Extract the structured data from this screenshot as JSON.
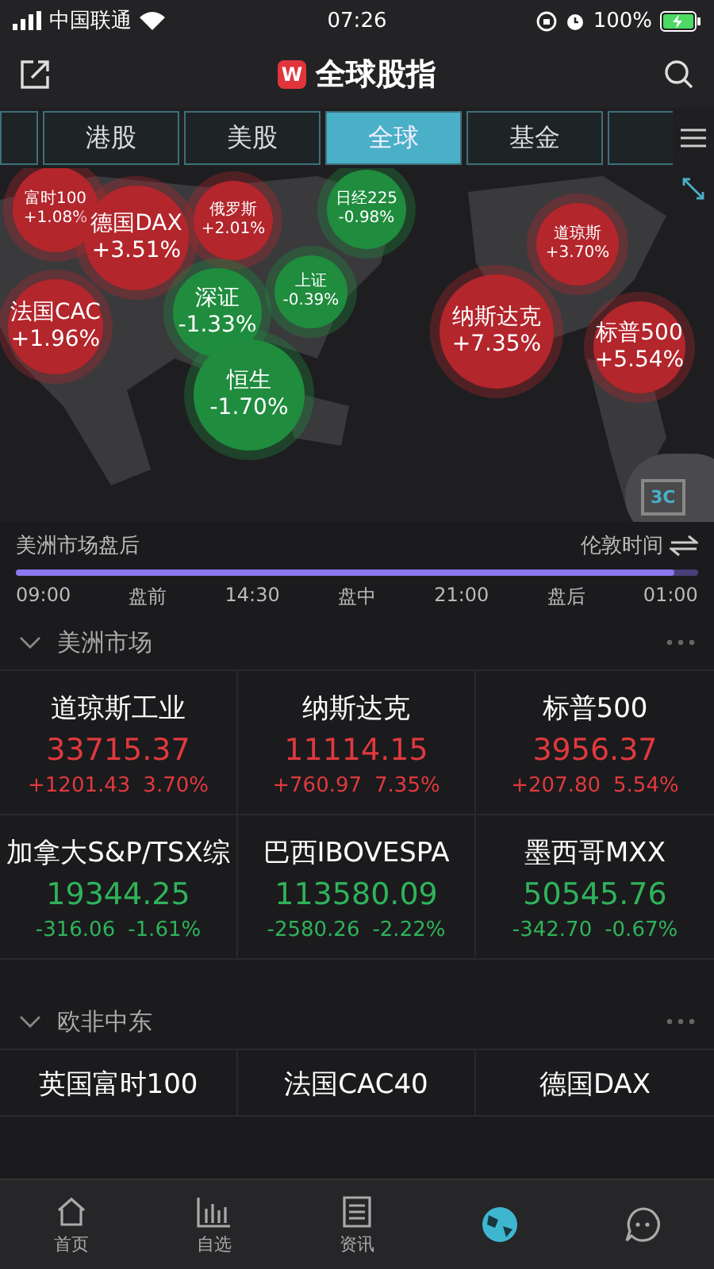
{
  "status_bar": {
    "carrier": "中国联通",
    "time": "07:26",
    "battery": "100%"
  },
  "header": {
    "logo": "W",
    "title": "全球股指"
  },
  "tabs": [
    {
      "selected": false
    },
    {
      "label": "港股",
      "selected": false
    },
    {
      "label": "美股",
      "selected": false
    },
    {
      "label": "全球",
      "selected": true
    },
    {
      "label": "基金",
      "selected": false
    },
    {
      "selected": false
    }
  ],
  "map": {
    "bubbles": [
      {
        "name": "富时100",
        "change": "+1.08%",
        "color": "#b3262c"
      },
      {
        "name": "德国DAX",
        "change": "+3.51%",
        "color": "#b3262c"
      },
      {
        "name": "俄罗斯",
        "change": "+2.01%",
        "color": "#b3262c"
      },
      {
        "name": "日经225",
        "change": "-0.98%",
        "color": "#1f8c3e"
      },
      {
        "name": "道琼斯",
        "change": "+3.70%",
        "color": "#b3262c"
      },
      {
        "name": "上证",
        "change": "-0.39%",
        "color": "#1f8c3e"
      },
      {
        "name": "深证",
        "change": "-1.33%",
        "color": "#1f8c3e"
      },
      {
        "name": "法国CAC",
        "change": "+1.96%",
        "color": "#b3262c"
      },
      {
        "name": "纳斯达克",
        "change": "+7.35%",
        "color": "#b3262c"
      },
      {
        "name": "标普500",
        "change": "+5.54%",
        "color": "#b3262c"
      },
      {
        "name": "恒生",
        "change": "-1.70%",
        "color": "#1f8c3e"
      }
    ],
    "view_button": "3C"
  },
  "session": {
    "label": "美洲市场盘后",
    "timezone": "伦敦时间",
    "level": 0.965,
    "ticks": [
      "09:00",
      "盘前",
      "14:30",
      "盘中",
      "21:00",
      "盘后",
      "01:00"
    ]
  },
  "sections": [
    {
      "title": "美洲市场",
      "expanded": true,
      "rows": [
        [
          {
            "name": "道琼斯工业",
            "price": "33715.37",
            "change": "+1201.43",
            "percent": "3.70%",
            "color": "#e0393e"
          },
          {
            "name": "纳斯达克",
            "price": "11114.15",
            "change": "+760.97",
            "percent": "7.35%",
            "color": "#e0393e"
          },
          {
            "name": "标普500",
            "price": "3956.37",
            "change": "+207.80",
            "percent": "5.54%",
            "color": "#e0393e"
          }
        ],
        [
          {
            "name": "加拿大S&P/TSX综",
            "price": "19344.25",
            "change": "-316.06",
            "percent": "-1.61%",
            "color": "#2fb35a"
          },
          {
            "name": "巴西IBOVESPA",
            "price": "113580.09",
            "change": "-2580.26",
            "percent": "-2.22%",
            "color": "#2fb35a"
          },
          {
            "name": "墨西哥MXX",
            "price": "50545.76",
            "change": "-342.70",
            "percent": "-0.67%",
            "color": "#2fb35a"
          }
        ]
      ]
    },
    {
      "title": "欧非中东",
      "expanded": true,
      "rows": [
        [
          {
            "name": "英国富时100"
          },
          {
            "name": "法国CAC40"
          },
          {
            "name": "德国DAX"
          }
        ]
      ]
    }
  ],
  "bottom_nav": [
    {
      "label": "首页",
      "kind": "home",
      "selected": false
    },
    {
      "label": "自选",
      "kind": "watchlist",
      "selected": false
    },
    {
      "label": "资讯",
      "kind": "news",
      "selected": false
    },
    {
      "kind": "globe",
      "selected": true
    },
    {
      "kind": "chat",
      "selected": false
    }
  ]
}
